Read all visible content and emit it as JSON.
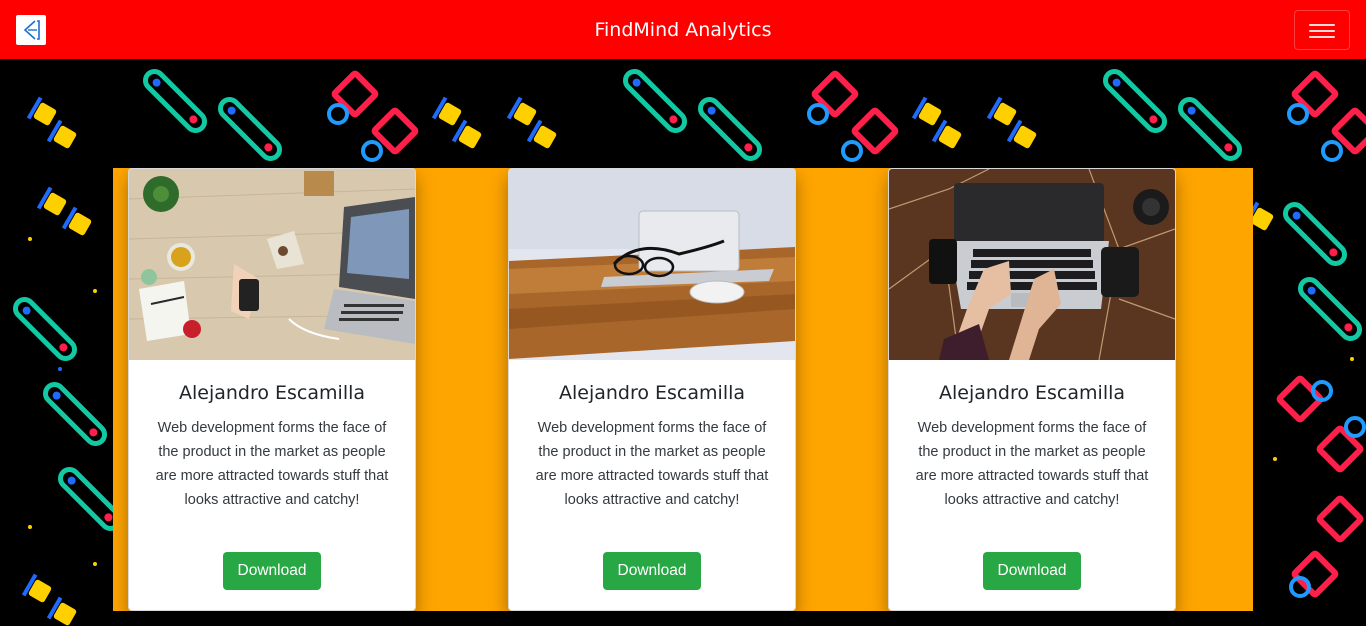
{
  "header": {
    "brand": "FindMind Analytics",
    "logo_icon": "document-logo-icon",
    "menu_icon": "hamburger-menu-icon"
  },
  "colors": {
    "navbar": "#ff0000",
    "panel": "#ffa500",
    "button": "#28a745"
  },
  "cards": [
    {
      "image": "desk-flatlay-with-laptop-phone-tea",
      "title": "Alejandro Escamilla",
      "text": "Web development forms the face of the product in the market as people are more attracted towards stuff that looks attractive and catchy!",
      "button": "Download"
    },
    {
      "image": "laptop-glasses-mouse-on-wooden-desk",
      "title": "Alejandro Escamilla",
      "text": "Web development forms the face of the product in the market as people are more attracted towards stuff that looks attractive and catchy!",
      "button": "Download"
    },
    {
      "image": "hands-typing-on-laptop-dark-desk",
      "title": "Alejandro Escamilla",
      "text": "Web development forms the face of the product in the market as people are more attracted towards stuff that looks attractive and catchy!",
      "button": "Download"
    }
  ]
}
